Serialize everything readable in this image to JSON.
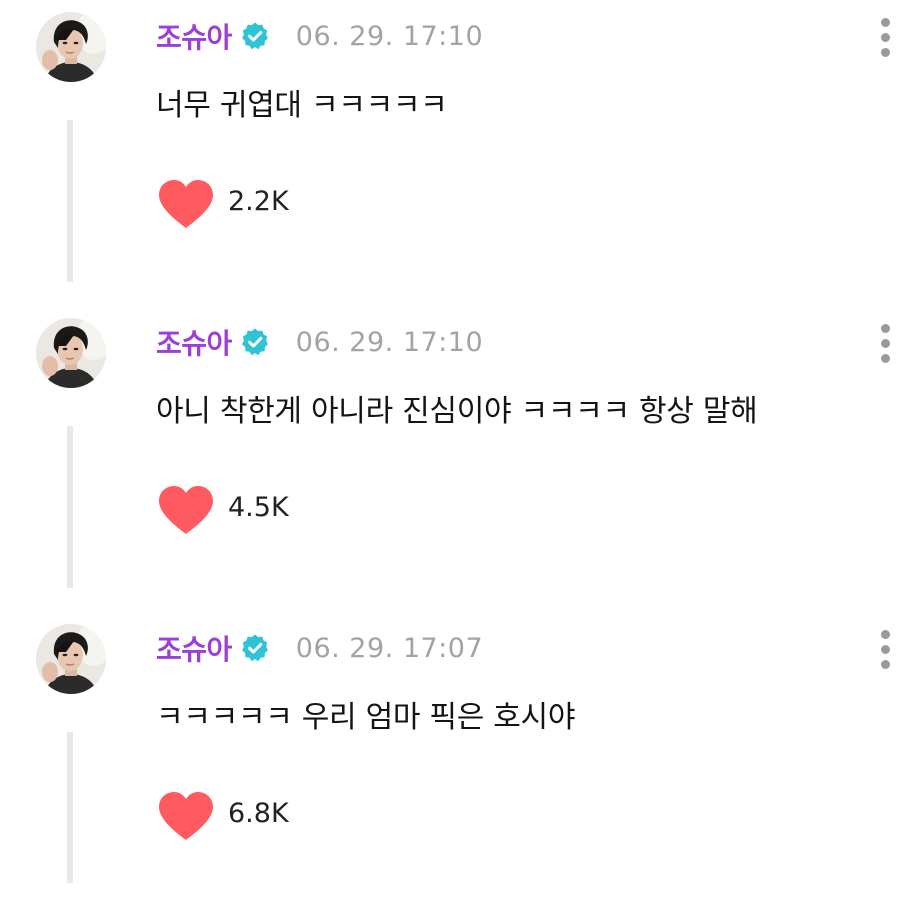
{
  "colors": {
    "author": "#9b3fd6",
    "verified_badge": "#2ec4d6",
    "heart": "#ff5a5f",
    "timestamp": "#a3a3a3",
    "thread_line": "#e8e8ec"
  },
  "comments": [
    {
      "author": "조슈아",
      "verified_icon": "verified-check-icon",
      "timestamp": "06. 29. 17:10",
      "text": "너무 귀엽대 ㅋㅋㅋㅋㅋ",
      "like_icon": "heart-icon",
      "likes": "2.2K"
    },
    {
      "author": "조슈아",
      "verified_icon": "verified-check-icon",
      "timestamp": "06. 29. 17:10",
      "text": "아니 착한게 아니라 진심이야 ㅋㅋㅋㅋ 항상 말해",
      "like_icon": "heart-icon",
      "likes": "4.5K"
    },
    {
      "author": "조슈아",
      "verified_icon": "verified-check-icon",
      "timestamp": "06. 29. 17:07",
      "text": "ㅋㅋㅋㅋㅋ 우리 엄마 픽은 호시야",
      "like_icon": "heart-icon",
      "likes": "6.8K"
    }
  ]
}
